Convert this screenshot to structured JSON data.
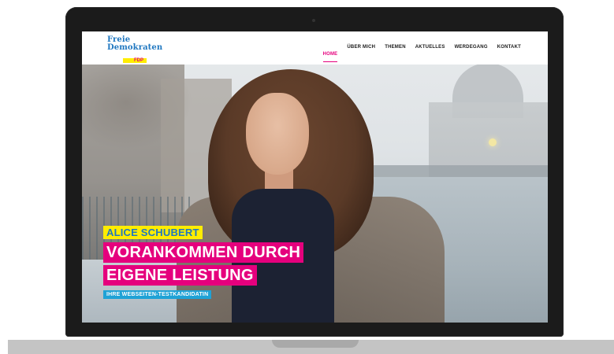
{
  "brand": {
    "line1": "Freie",
    "line2": "Demokraten",
    "badge": "FDP",
    "colors": {
      "blue": "#1f77c0",
      "magenta": "#e5007d",
      "yellow": "#ffed00",
      "cyan": "#1fa2d6"
    }
  },
  "nav": {
    "items": [
      {
        "label": "HOME",
        "active": true
      },
      {
        "label": "ÜBER MICH",
        "active": false
      },
      {
        "label": "THEMEN",
        "active": false
      },
      {
        "label": "AKTUELLES",
        "active": false
      },
      {
        "label": "WERDEGANG",
        "active": false
      },
      {
        "label": "KONTAKT",
        "active": false
      }
    ]
  },
  "hero": {
    "name": "ALICE SCHUBERT",
    "headline_line1": "VORANKOMMEN DURCH",
    "headline_line2": "EIGENE LEISTUNG",
    "subtitle": "IHRE WEBSEITEN-TESTKANDIDATIN"
  }
}
